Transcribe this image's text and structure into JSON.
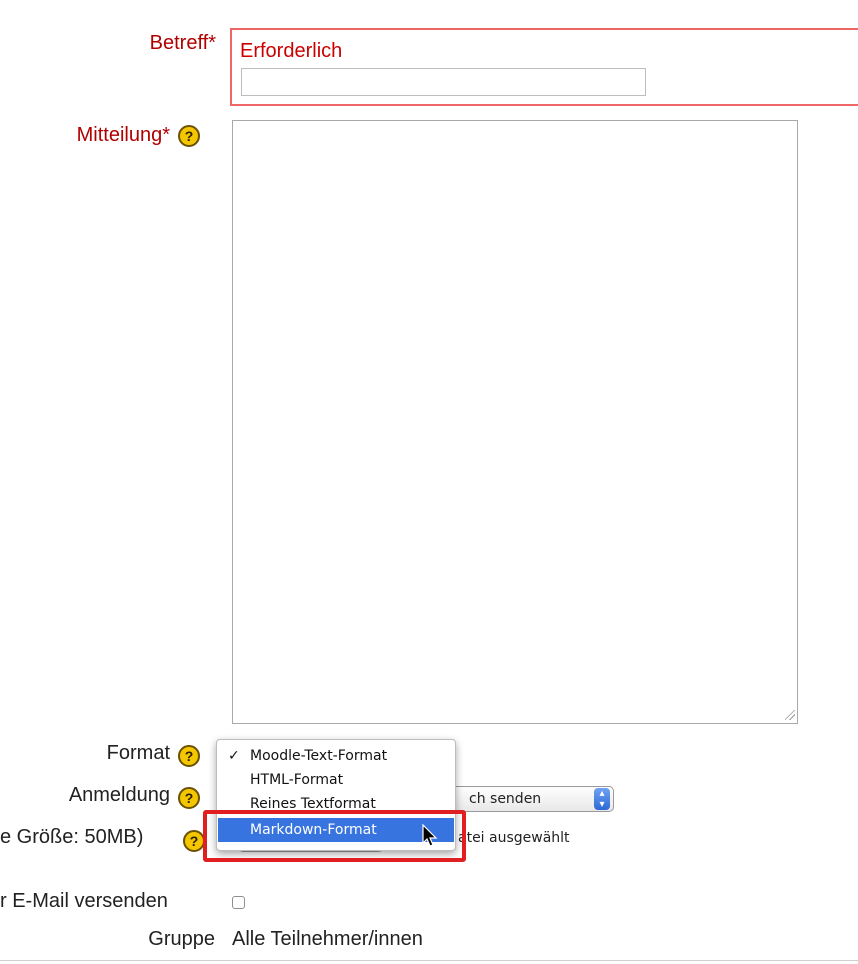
{
  "subject": {
    "label": "Betreff*",
    "required_text": "Erforderlich",
    "value": ""
  },
  "message": {
    "label": "Mitteilung*",
    "help_icon": "help-icon",
    "value": ""
  },
  "format": {
    "label": "Format",
    "options": [
      {
        "label": "Moodle-Text-Format",
        "checked": true
      },
      {
        "label": "HTML-Format",
        "checked": false
      },
      {
        "label": "Reines Textformat",
        "checked": false
      },
      {
        "label": "Markdown-Format",
        "checked": false,
        "highlighted": true
      }
    ],
    "checkmark": "✓"
  },
  "subscription": {
    "label": "Anmeldung",
    "select_value_visible": "ch senden"
  },
  "attachment": {
    "label": "e Größe: 50MB)",
    "file_status": "atei ausgewählt"
  },
  "email": {
    "label": "r E-Mail versenden"
  },
  "group": {
    "label": "Gruppe",
    "value": "Alle Teilnehmer/innen"
  },
  "colors": {
    "required": "#b00000",
    "error_border": "#e66666",
    "highlight": "#e02020",
    "selected_option": "#3874e0",
    "help_icon": "#f3c600"
  }
}
